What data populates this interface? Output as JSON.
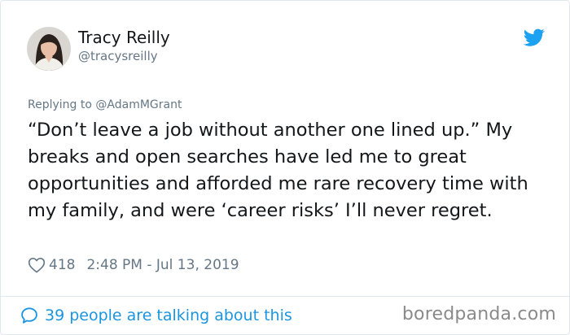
{
  "tweet": {
    "author_name": "Tracy Reilly",
    "author_handle": "@tracysreilly",
    "replying_prefix": "Replying to ",
    "replying_to": "@AdamMGrant",
    "text": "“Don’t leave a job without another one lined up.” My breaks and open searches have led me to great opportunities and afforded me rare recovery time with my family, and were ‘career risks’ I’ll never regret.",
    "like_count": "418",
    "timestamp": "2:48 PM - Jul 13, 2019",
    "talking_label": "39 people are talking about this"
  },
  "icons": {
    "platform": "twitter-bird-icon",
    "like": "heart-icon",
    "conversation": "speech-bubble-icon"
  },
  "watermark": "boredpanda.com",
  "colors": {
    "brand": "#1da1f2",
    "link": "#1b95e0",
    "text": "#14171a",
    "muted": "#657786",
    "border": "#e1e8ed"
  }
}
